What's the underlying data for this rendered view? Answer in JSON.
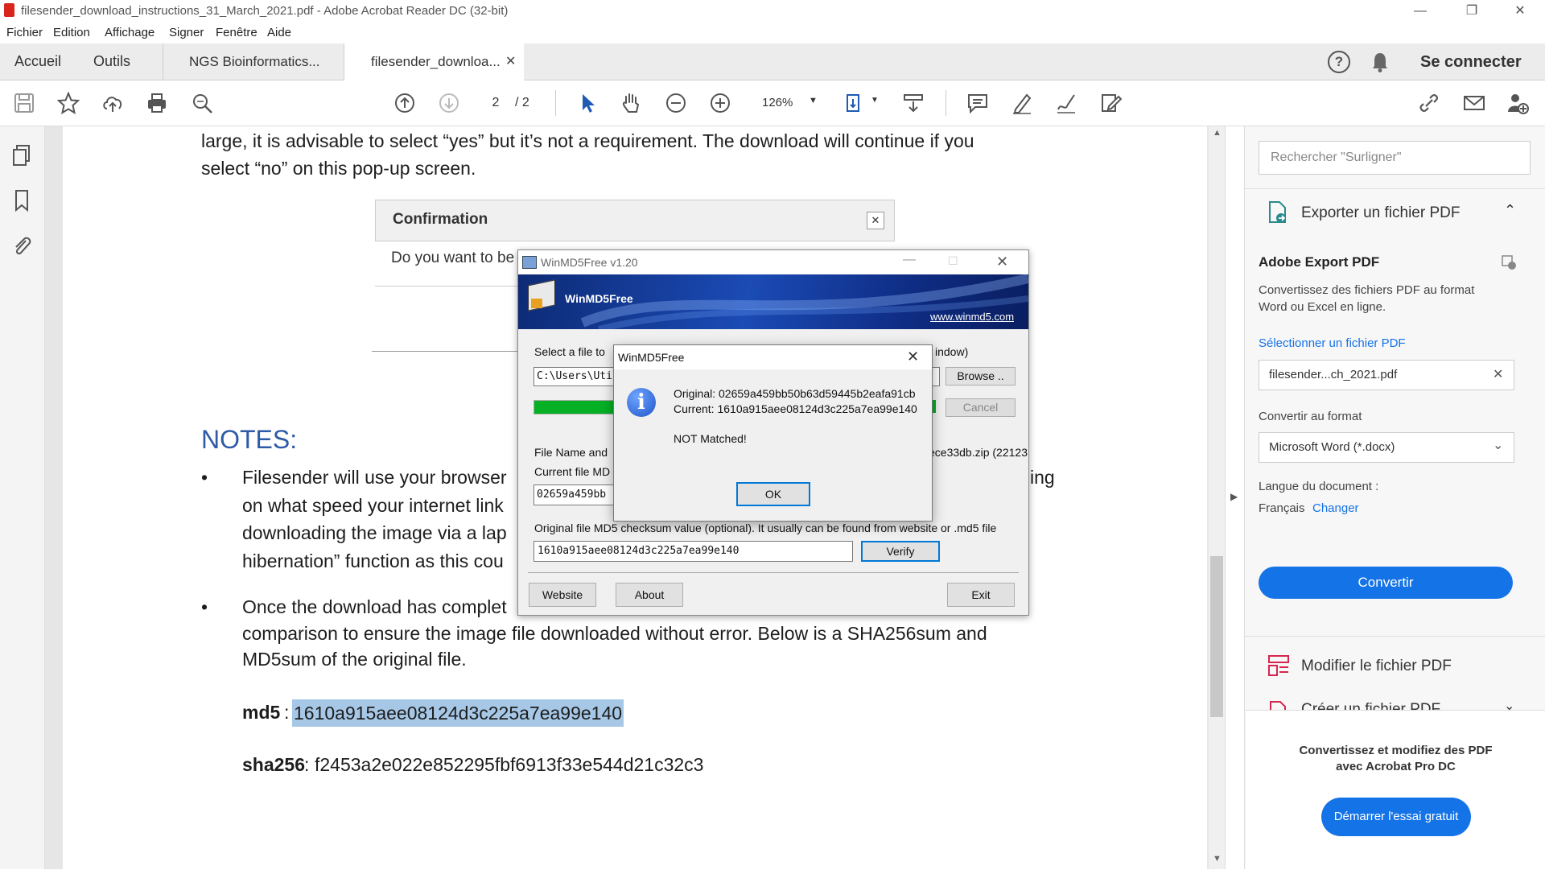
{
  "window": {
    "title": "filesender_download_instructions_31_March_2021.pdf - Adobe Acrobat Reader DC (32-bit)"
  },
  "menu": [
    "Fichier",
    "Edition",
    "Affichage",
    "Signer",
    "Fenêtre",
    "Aide"
  ],
  "tabs": {
    "home": "Accueil",
    "tools": "Outils",
    "doc1": "NGS Bioinformatics...",
    "doc2": "filesender_downloa...",
    "signin": "Se connecter"
  },
  "toolbar": {
    "page_current": "2",
    "page_total": "/ 2",
    "zoom": "126%"
  },
  "doc": {
    "line1": "large, it is advisable to select “yes” but it’s not a requirement.  The download will continue if you",
    "line2": "select “no” on this pop-up screen.",
    "notes_heading": "NOTES:",
    "bullet1_l1": "Filesender will use your browser",
    "bullet1_l1_end": "ing",
    "bullet1_l2": "on what speed your internet link",
    "bullet1_l3": "downloading the image via a lap",
    "bullet1_l4": "hibernation” function as this cou",
    "bullet2_l1": "Once the download has complet",
    "bullet2_l2": "comparison to ensure the image file downloaded without error.   Below is a SHA256sum and",
    "bullet2_l3": "MD5sum of the original file.",
    "md5_label": "md5",
    "md5_value": "1610a915aee08124d3c225a7ea99e140",
    "sha_label": "sha256",
    "sha_value": "f2453a2e022e852295fbf6913f33e544d21c32c3"
  },
  "confirmation": {
    "title": "Confirmation",
    "text": "Do you want to be"
  },
  "winmd5": {
    "title": "WinMD5Free v1.20",
    "banner_name": "WinMD5Free",
    "banner_link": "www.winmd5.com",
    "select_label": "Select a file to",
    "select_label_end": "indow)",
    "path_value": "C:\\Users\\Utilis",
    "browse": "Browse ..",
    "cancel": "Cancel",
    "filename_label": "File Name and",
    "filename_end": "ece33db.zip (22123",
    "current_label": "Current file MD",
    "current_value": "02659a459bb",
    "original_label": "Original file MD5 checksum value (optional). It usually can be found from website or .md5 file",
    "original_value": "1610a915aee08124d3c225a7ea99e140",
    "verify": "Verify",
    "website": "Website",
    "about": "About",
    "exit": "Exit"
  },
  "msgbox": {
    "title": "WinMD5Free",
    "original": "Original: 02659a459bb50b63d59445b2eafa91cb",
    "current": "Current: 1610a915aee08124d3c225a7ea99e140",
    "result": "NOT Matched!",
    "ok": "OK"
  },
  "rightpanel": {
    "search_placeholder": "Rechercher \"Surligner\"",
    "export_title": "Exporter un fichier PDF",
    "adobe_export": "Adobe Export PDF",
    "desc1": "Convertissez des fichiers PDF au format",
    "desc2": "Word ou Excel en ligne.",
    "select_link": "Sélectionner un fichier PDF",
    "file_value": "filesender...ch_2021.pdf",
    "convert_to": "Convertir au format",
    "format_value": "Microsoft Word (*.docx)",
    "lang_label": "Langue du document :",
    "lang_value": "Français",
    "lang_change": "Changer",
    "convert_btn": "Convertir",
    "modify": "Modifier le fichier PDF",
    "create": "Créer un fichier PDF",
    "promo1": "Convertissez et modifiez des PDF",
    "promo2": "avec Acrobat Pro DC",
    "trial_btn": "Démarrer l'essai gratuit"
  },
  "colors": {
    "accent": "#1473e6",
    "highlight": "#a6c8e6",
    "winmd5_banner": "#12338a"
  }
}
